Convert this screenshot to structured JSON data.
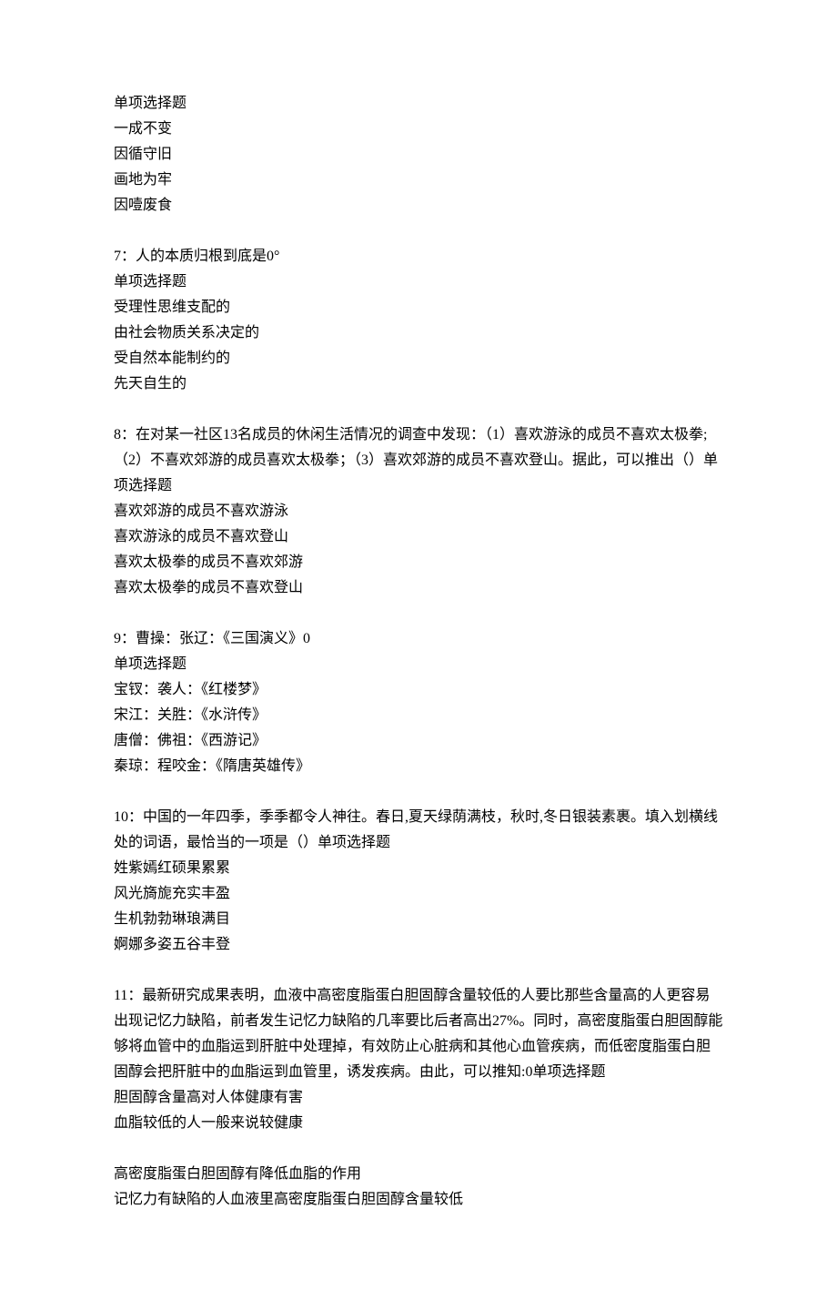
{
  "blocks": [
    {
      "lines": [
        "单项选择题",
        "一成不变",
        "因循守旧",
        "画地为牢",
        "因噎废食"
      ]
    },
    {
      "lines": [
        "7：人的本质归根到底是0°",
        "单项选择题",
        "受理性思维支配的",
        "由社会物质关系决定的",
        "受自然本能制约的",
        "先天自生的"
      ]
    },
    {
      "lines": [
        "8：在对某一社区13名成员的休闲生活情况的调查中发现：（1）喜欢游泳的成员不喜欢太极拳;（2）不喜欢郊游的成员喜欢太极拳；（3）喜欢郊游的成员不喜欢登山。据此，可以推出（）单项选择题",
        "喜欢郊游的成员不喜欢游泳",
        "喜欢游泳的成员不喜欢登山",
        "喜欢太极拳的成员不喜欢郊游",
        "喜欢太极拳的成员不喜欢登山"
      ]
    },
    {
      "lines": [
        "9：曹操：张辽：《三国演义》0",
        "单项选择题",
        "宝钗：袭人：《红楼梦》",
        "宋江：关胜：《水浒传》",
        "唐僧：佛祖：《西游记》",
        "秦琼：程咬金：《隋唐英雄传》"
      ]
    },
    {
      "lines": [
        "10：中国的一年四季，季季都令人神往。春日,夏天绿荫满枝，秋时,冬日银装素裹。填入划横线处的词语，最恰当的一项是（）单项选择题",
        "姓紫嫣红硕果累累",
        "风光旖旎充实丰盈",
        "生机勃勃琳琅满目",
        "婀娜多姿五谷丰登"
      ]
    },
    {
      "lines": [
        "11：最新研究成果表明，血液中高密度脂蛋白胆固醇含量较低的人要比那些含量高的人更容易出现记忆力缺陷，前者发生记忆力缺陷的几率要比后者高出27%。同时，高密度脂蛋白胆固醇能够将血管中的血脂运到肝脏中处理掉，有效防止心脏病和其他心血管疾病，而低密度脂蛋白胆固醇会把肝脏中的血脂运到血管里，诱发疾病。由此，可以推知:0单项选择题",
        "胆固醇含量高对人体健康有害",
        "血脂较低的人一般来说较健康"
      ]
    },
    {
      "lines": [
        "高密度脂蛋白胆固醇有降低血脂的作用",
        "记忆力有缺陷的人血液里高密度脂蛋白胆固醇含量较低"
      ]
    }
  ]
}
